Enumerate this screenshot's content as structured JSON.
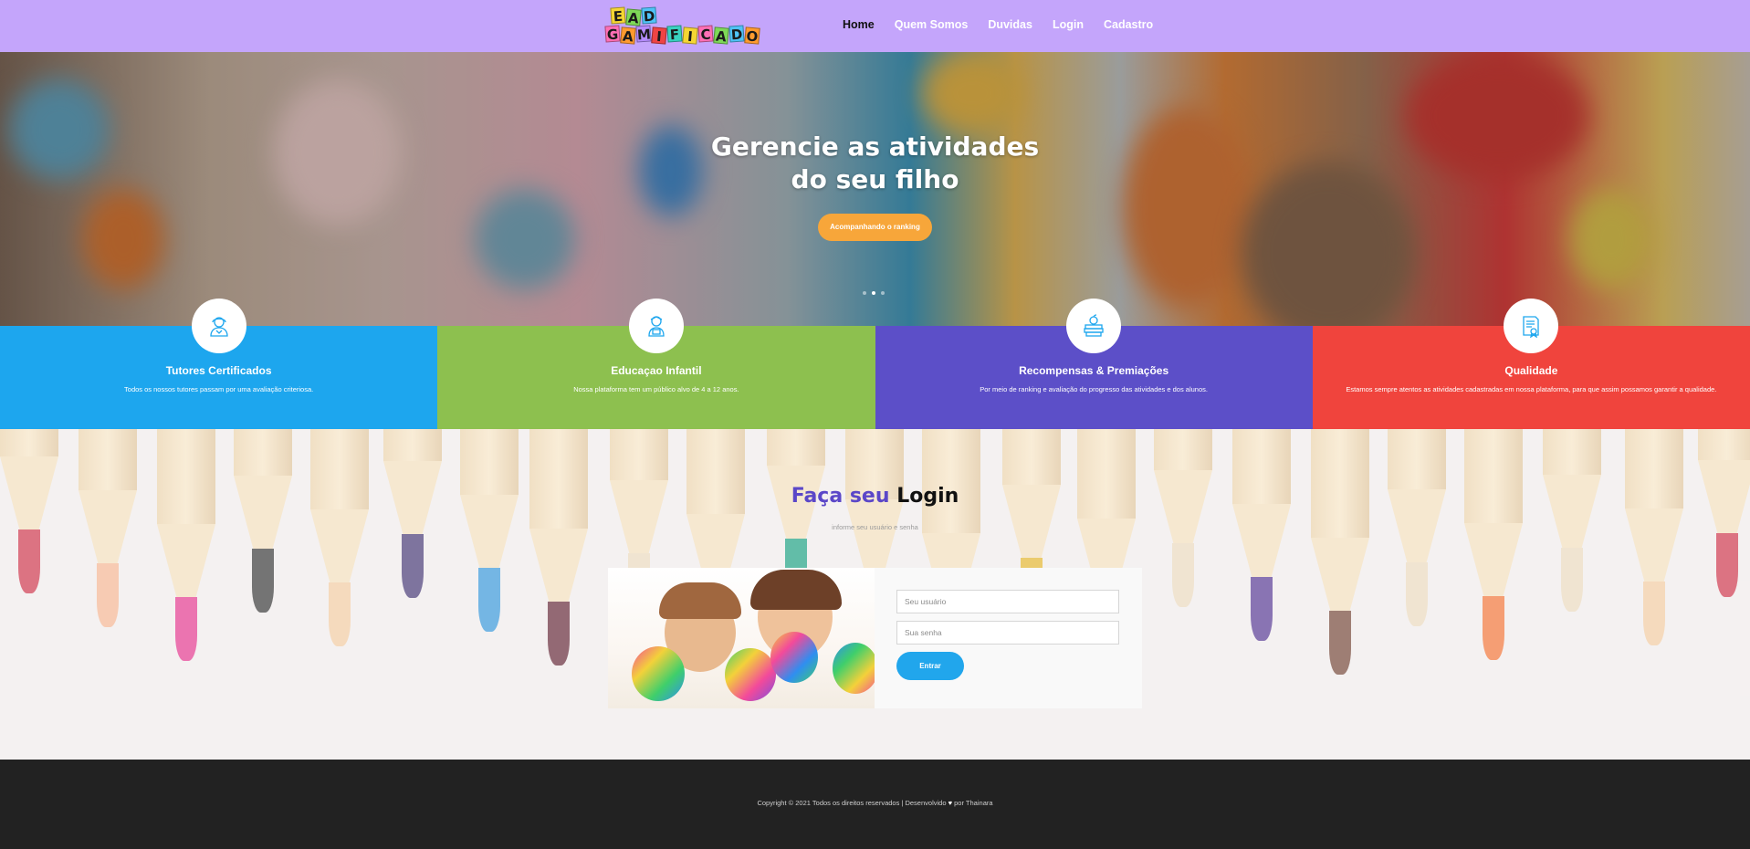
{
  "logo": {
    "row1": [
      "E",
      "A",
      "D"
    ],
    "row2": [
      "G",
      "A",
      "M",
      "I",
      "F",
      "I",
      "C",
      "A",
      "D",
      "O"
    ],
    "colors": [
      "#f5d633",
      "#7ed957",
      "#4fc3f7",
      "#ff6fb5",
      "#ff9b2f",
      "#b58cff",
      "#ef4444",
      "#39d2c0",
      "#f5d633",
      "#ff6fb5",
      "#7ed957",
      "#4fc3f7",
      "#ff9b2f"
    ]
  },
  "nav": {
    "items": [
      {
        "label": "Home",
        "active": true
      },
      {
        "label": "Quem Somos"
      },
      {
        "label": "Duvidas"
      },
      {
        "label": "Login"
      },
      {
        "label": "Cadastro"
      }
    ]
  },
  "hero": {
    "title_line1": "Gerencie as atividades",
    "title_line2": "do seu filho",
    "button": "Acompanhando o ranking",
    "slides": 3,
    "active_slide": 2
  },
  "features": [
    {
      "title": "Tutores Certificados",
      "text": "Todos os nossos tutores passam por uma avaliação criteriosa.",
      "color": "#1da6ee",
      "icon": "tutor-icon"
    },
    {
      "title": "Educaçao Infantil",
      "text": "Nossa plataforma tem um público alvo de 4 a 12 anos.",
      "color": "#8dc04f",
      "icon": "student-icon"
    },
    {
      "title": "Recompensas & Premiações",
      "text": "Por meio de ranking e avaliação do progresso das atividades e dos alunos.",
      "color": "#5c4fc8",
      "icon": "books-apple-icon"
    },
    {
      "title": "Qualidade",
      "text": "Estamos sempre atentos as atividades cadastradas em nossa plataforma, para que assim possamos garantir a qualidade.",
      "color": "#f0443d",
      "icon": "certificate-icon"
    }
  ],
  "login": {
    "title_highlight": "Faça seu",
    "title_rest": "Login",
    "subtitle": "informe seu usuário e senha",
    "user_placeholder": "Seu usuário",
    "pass_placeholder": "Sua senha",
    "button": "Entrar"
  },
  "footer": {
    "text_before": "Copyright © 2021 Todos os direitos reservados | Desenvolvido",
    "heart": "♥",
    "text_after": "por Thainara"
  }
}
